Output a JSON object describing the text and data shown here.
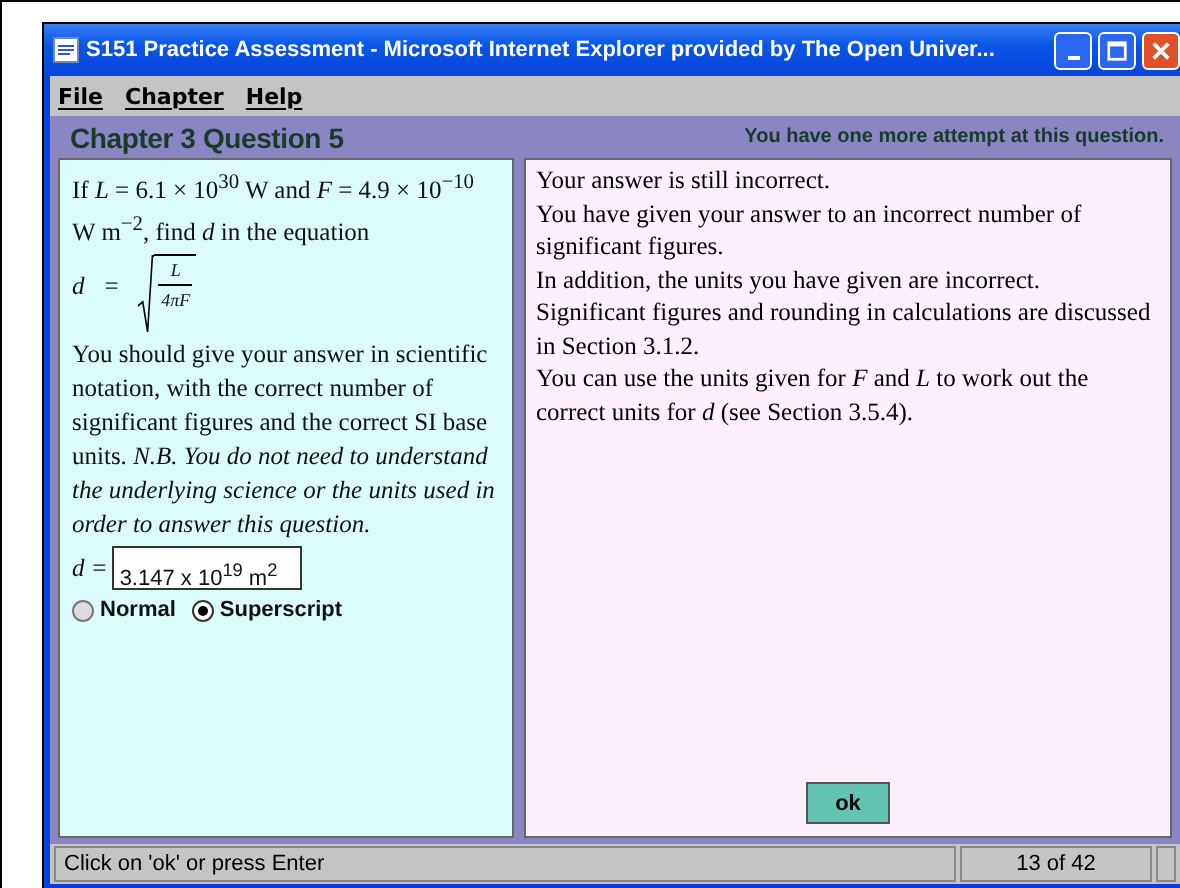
{
  "window": {
    "title": "S151 Practice Assessment - Microsoft Internet Explorer provided by The Open Univer..."
  },
  "menu": [
    {
      "label": "File"
    },
    {
      "label": "Chapter"
    },
    {
      "label": "Help"
    }
  ],
  "header": {
    "title": "Chapter 3 Question 5",
    "attempts": "You have one more attempt at this question."
  },
  "question": {
    "intro": "If *L* = 6.1 × 10$^{30}$ W and *F* = 4.9 × 10$^{−10}$ W m$^{−2}$, find *d* in the equation",
    "formula": {
      "lhs": "d",
      "equals": "=",
      "numerator": "L",
      "denominator": "4πF"
    },
    "instructions": "You should give your answer in scientific notation, with the correct number of significant figures and the correct SI base units. *N.B. You do not need to understand the underlying science or the units used in order to answer this question.*",
    "answer_label": "d =",
    "answer_value": "3.147 x 10$^{19}$ m$^{2}$",
    "modes": [
      {
        "label": "Normal",
        "selected": false
      },
      {
        "label": "Superscript",
        "selected": true
      }
    ]
  },
  "feedback": {
    "lines": [
      "Your answer is still incorrect.",
      "You have given your answer to an incorrect number of significant figures.",
      "In addition, the units you have given are incorrect.",
      "Significant figures and rounding in calculations  are discussed in Section 3.1.2.",
      "You can use the units given for *F* and *L* to work out the correct units for *d* (see Section 3.5.4)."
    ],
    "button": "ok"
  },
  "status_bar": {
    "message": "Click on 'ok' or press Enter",
    "position": "13 of 42"
  }
}
